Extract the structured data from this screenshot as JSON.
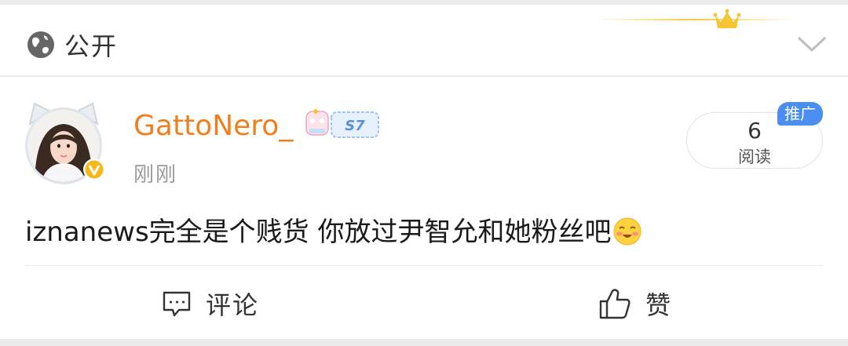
{
  "header": {
    "visibility_icon": "globe-icon",
    "visibility_label": "公开",
    "decoration_icon": "crown-icon",
    "expand_icon": "chevron-down-icon"
  },
  "post": {
    "author": {
      "nickname": "GattoNero_",
      "badge_text": "S7",
      "verified_icon": "verified-v-icon",
      "name_color": "#f0801e"
    },
    "time": "刚刚",
    "reads": {
      "count": "6",
      "label": "阅读"
    },
    "promo_label": "推广",
    "content_text": "iznanews完全是个贱货 你放过尹智允和她粉丝吧",
    "content_emoji": "blush-face-emoji"
  },
  "actions": {
    "comment_label": "评论",
    "comment_icon": "comment-icon",
    "like_label": "赞",
    "like_icon": "thumbs-up-icon"
  },
  "colors": {
    "accent_blue": "#4a8ff0",
    "gold": "#f5c93b"
  }
}
